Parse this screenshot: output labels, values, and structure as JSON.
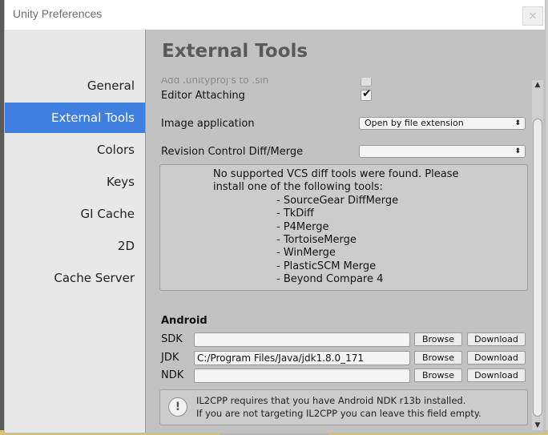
{
  "window": {
    "title": "Unity Preferences",
    "close_label": "×"
  },
  "sidebar": {
    "items": [
      {
        "label": "General"
      },
      {
        "label": "External Tools"
      },
      {
        "label": "Colors"
      },
      {
        "label": "Keys"
      },
      {
        "label": "GI Cache"
      },
      {
        "label": "2D"
      },
      {
        "label": "Cache Server"
      }
    ],
    "active": "External Tools"
  },
  "content": {
    "title": "External Tools",
    "faded_row": "Add .unityproj's to .sln",
    "editor_attaching": {
      "label": "Editor Attaching",
      "checked": true
    },
    "image_application": {
      "label": "Image application",
      "value": "Open by file extension"
    },
    "revision_control": {
      "label": "Revision Control Diff/Merge",
      "value": ""
    },
    "vcs_message": {
      "line1": "No supported VCS diff tools were found. Please",
      "line2": "install one of the following tools:",
      "tools": [
        "- SourceGear DiffMerge",
        "- TkDiff",
        "- P4Merge",
        "- TortoiseMerge",
        "- WinMerge",
        "- PlasticSCM Merge",
        "- Beyond Compare 4"
      ]
    },
    "android": {
      "section": "Android",
      "rows": [
        {
          "label": "SDK",
          "value": "",
          "browse": "Browse",
          "download": "Download"
        },
        {
          "label": "JDK",
          "value": "C:/Program Files/Java/jdk1.8.0_171",
          "browse": "Browse",
          "download": "Download"
        },
        {
          "label": "NDK",
          "value": "",
          "browse": "Browse",
          "download": "Download"
        }
      ],
      "info_line1": "IL2CPP requires that you have Android NDK r13b installed.",
      "info_line2": "If you are not targeting IL2CPP you can leave this field empty."
    }
  },
  "colors": {
    "accent": "#3e7fe0",
    "panel": "#c2c2c2",
    "sidebar": "#e8e8e8"
  }
}
